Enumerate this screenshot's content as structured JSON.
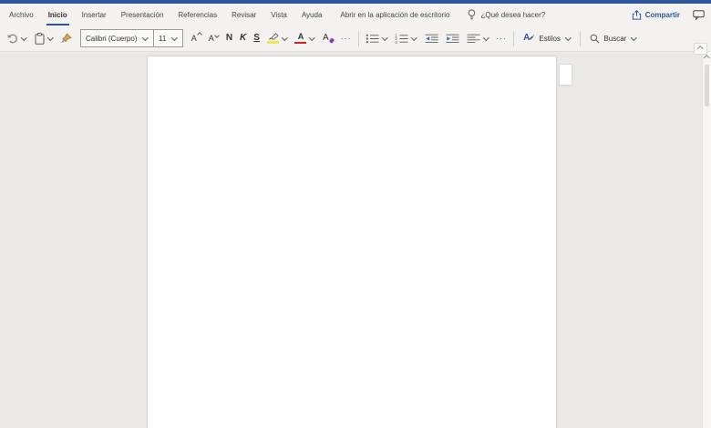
{
  "menu_bar": {
    "tabs": [
      {
        "label": "Archivo",
        "active": false
      },
      {
        "label": "Inicio",
        "active": true
      },
      {
        "label": "Insertar",
        "active": false
      },
      {
        "label": "Presentación",
        "active": false
      },
      {
        "label": "Referencias",
        "active": false
      },
      {
        "label": "Revisar",
        "active": false
      },
      {
        "label": "Vista",
        "active": false
      },
      {
        "label": "Ayuda",
        "active": false
      }
    ],
    "open_in_desktop_label": "Abrir en la aplicación de escritorio",
    "tell_me_label": "¿Qué desea hacer?",
    "share_label": "Compartir"
  },
  "ribbon": {
    "font_name": "Calibri (Cuerpo)",
    "font_size": "11",
    "grow_font_letter": "A",
    "shrink_font_letter": "A",
    "bold_label": "N",
    "italic_label": "K",
    "underline_label": "S",
    "font_color_letter": "A",
    "clear_format_letter": "A",
    "more_font_label": "···",
    "more_paragraph_label": "···",
    "styles_letter": "A",
    "styles_label": "Estilos",
    "search_label": "Buscar"
  },
  "icons": {
    "undo": "curved-left-arrow",
    "paste": "clipboard",
    "format_painter": "brush",
    "highlighter": "marker-pen-yellow-bar",
    "font_color": "A-red-bar",
    "clear_format": "A-purple-eraser",
    "bullets": "bulleted-list",
    "numbering": "numbered-list",
    "numbering_digits": [
      "1",
      "2",
      "3"
    ],
    "outdent": "blue-arrow-left-lines",
    "indent": "blue-arrow-right-lines",
    "align": "align-lines",
    "styles": "A-pen",
    "search": "magnifier",
    "lightbulb": "lightbulb",
    "share": "box-arrow-up",
    "comments": "speech-bubble",
    "collapse_ribbon": "caret-up",
    "scroll_up": "caret-up"
  },
  "colors": {
    "brand_blue": "#2b579a",
    "bar_bg": "#f3f2f1",
    "canvas_bg": "#eae9e8",
    "page_bg": "#ffffff",
    "highlight_yellow": "#f3e44c",
    "font_color_red": "#c62324",
    "clear_format_purple": "#9536b4",
    "format_painter_tan": "#d9a55a",
    "indent_arrow_blue": "#3a6db5",
    "icon_gray": "#605e5c",
    "text_dark": "#323130"
  }
}
